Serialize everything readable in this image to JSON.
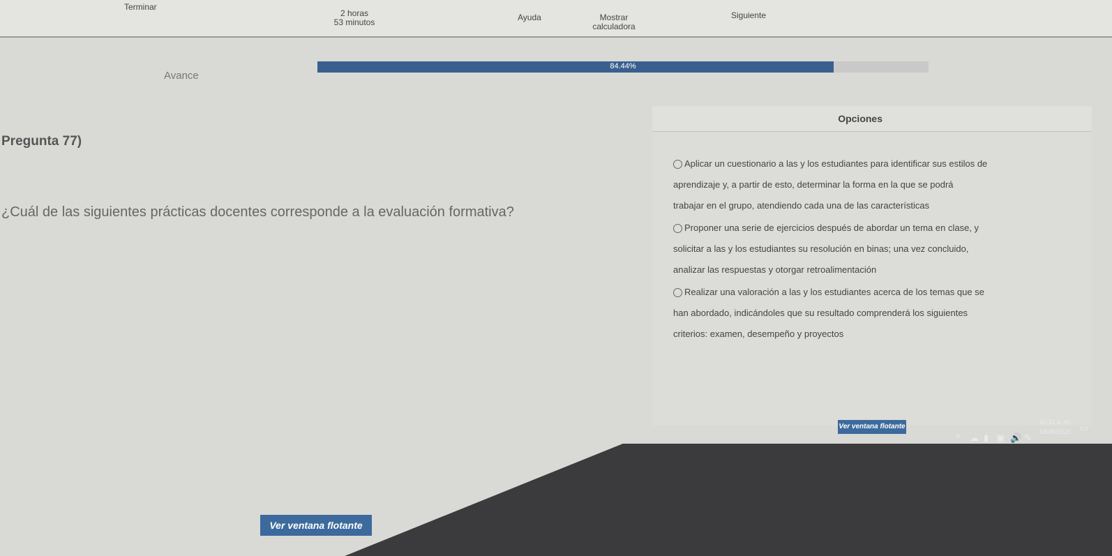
{
  "topbar": {
    "finish": "Terminar",
    "timer_hours": "2 horas",
    "timer_minutes": "53 minutos",
    "help": "Ayuda",
    "calculator_line1": "Mostrar",
    "calculator_line2": "calculadora",
    "next": "Siguiente"
  },
  "progress": {
    "label": "Avance",
    "percent_text": "84.44%",
    "value": 84.44
  },
  "question": {
    "number": "Pregunta 77)",
    "text": "¿Cuál de las siguientes prácticas docentes corresponde a la evaluación formativa?"
  },
  "options": {
    "header": "Opciones",
    "items": [
      {
        "lines": [
          "Aplicar un cuestionario a las y los estudiantes para identificar sus estilos de",
          "aprendizaje y, a partir de esto, determinar la forma en la que se podrá",
          "trabajar en el grupo, atendiendo cada una de las características"
        ]
      },
      {
        "lines": [
          "Proponer una serie de ejercicios después de abordar un tema en clase, y",
          "solicitar a las y los estudiantes su resolución en binas; una vez concluido,",
          "analizar las respuestas y otorgar retroalimentación"
        ]
      },
      {
        "lines": [
          "Realizar una valoración a las y los estudiantes acerca de los temas que se",
          "han abordado, indicándoles que su resultado comprenderá los siguientes",
          "criterios: examen, desempeño y proyectos"
        ]
      }
    ]
  },
  "floating_window": {
    "small_label": "Ver ventana flotante",
    "large_label": "Ver ventana flotante"
  },
  "taskbar": {
    "time": "10:31 a. m.",
    "date": "18/05/2025"
  },
  "colors": {
    "progress_fill": "#3a5f8f",
    "button_blue": "#3c6a9c"
  }
}
